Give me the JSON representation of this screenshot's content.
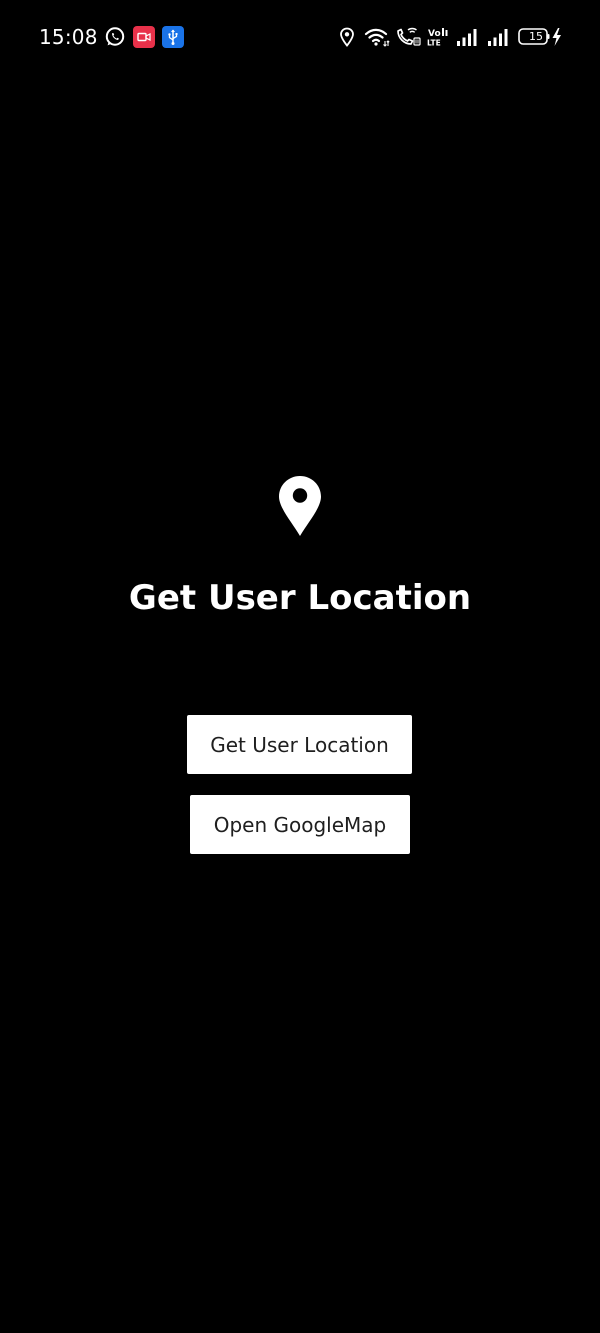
{
  "status_bar": {
    "time": "15:08",
    "battery_level": "15",
    "notification_icons": [
      "whatsapp-icon",
      "screen-recorder-icon",
      "usb-icon"
    ],
    "system_icons": [
      "location-icon",
      "wifi-icon",
      "wifi-calling-icon",
      "volte-icon",
      "signal-icon",
      "signal-icon",
      "battery-icon",
      "charging-icon"
    ],
    "colors": {
      "recorder_badge": "#e8314a",
      "usb_badge": "#1a73e8"
    }
  },
  "main": {
    "header_icon": "map-pin-icon",
    "title": "Get User Location",
    "buttons": {
      "get_location_label": "Get User Location",
      "open_map_label": "Open GoogleMap"
    }
  },
  "colors": {
    "background": "#000000",
    "foreground": "#ffffff",
    "button_background": "#ffffff",
    "button_text": "#1f1f1f"
  }
}
